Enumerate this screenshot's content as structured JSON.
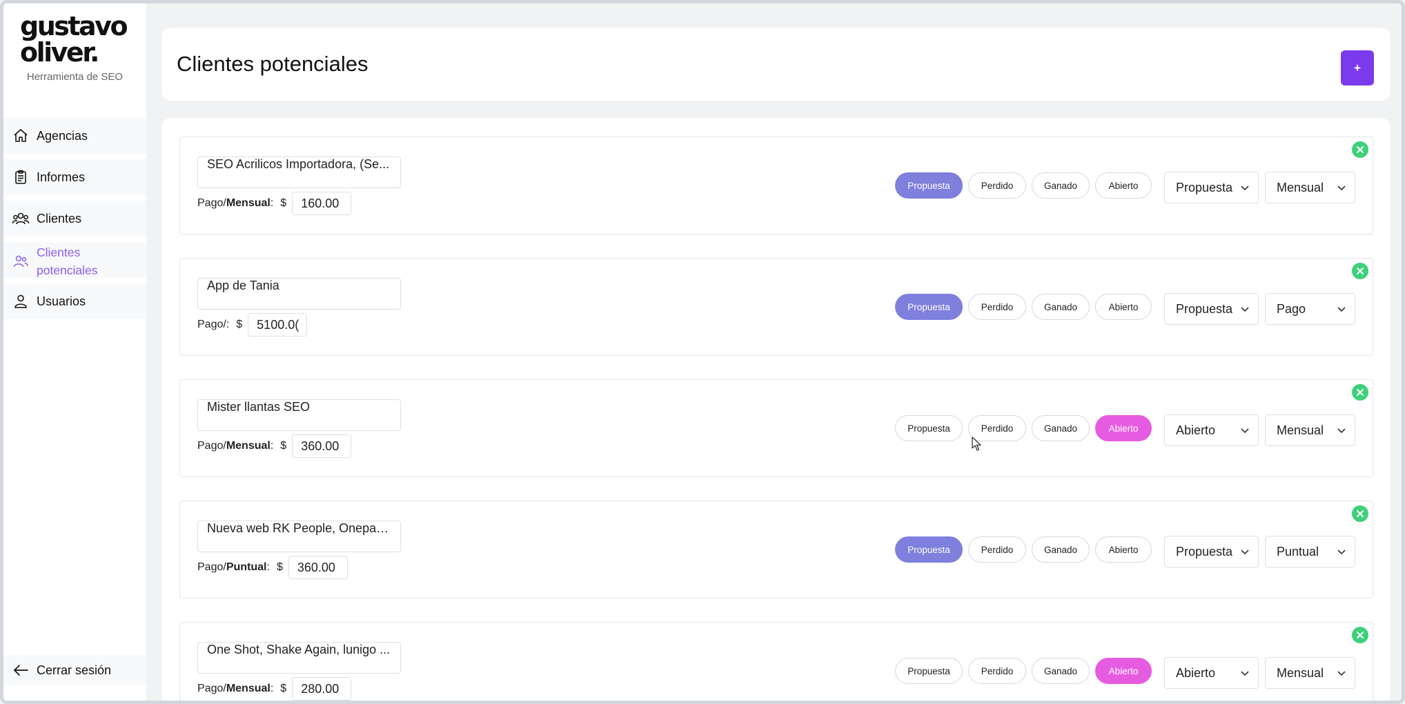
{
  "brand": {
    "logo_line1": "gustavo",
    "logo_line2": "oliver.",
    "subtitle": "Herramienta de SEO"
  },
  "sidebar": {
    "items": [
      {
        "label": "Agencias",
        "icon": "home-icon"
      },
      {
        "label": "Informes",
        "icon": "clipboard-icon"
      },
      {
        "label": "Clientes",
        "icon": "users-icon"
      },
      {
        "label": "Clientes potenciales",
        "icon": "users-outline-icon",
        "active": true
      },
      {
        "label": "Usuarios",
        "icon": "user-icon"
      }
    ],
    "logout_label": "Cerrar sesión"
  },
  "header": {
    "title": "Clientes potenciales",
    "add_label": "+"
  },
  "status_options": [
    "Propuesta",
    "Perdido",
    "Ganado",
    "Abierto"
  ],
  "leads": [
    {
      "name": "SEO Acrilicos Importadora, (Se...",
      "pay_prefix": "Pago/",
      "pay_type": "Mensual",
      "pay_suffix": ":",
      "currency": "$",
      "amount": "160.00",
      "status": "Propuesta",
      "status_select": "Propuesta",
      "frequency": "Mensual"
    },
    {
      "name": "App de Tania",
      "pay_prefix": "Pago/",
      "pay_type": "",
      "pay_suffix": ":",
      "currency": "$",
      "amount": "5100.0(",
      "status": "Propuesta",
      "status_select": "Propuesta",
      "frequency": "Pago"
    },
    {
      "name": "Mister llantas SEO",
      "pay_prefix": "Pago/",
      "pay_type": "Mensual",
      "pay_suffix": ":",
      "currency": "$",
      "amount": "360.00",
      "status": "Abierto",
      "status_select": "Abierto",
      "frequency": "Mensual"
    },
    {
      "name": "Nueva web RK People, Onepag...",
      "pay_prefix": "Pago/",
      "pay_type": "Puntual",
      "pay_suffix": ":",
      "currency": "$",
      "amount": "360.00",
      "status": "Propuesta",
      "status_select": "Propuesta",
      "frequency": "Puntual"
    },
    {
      "name": "One Shot, Shake Again, lunigo ...",
      "pay_prefix": "Pago/",
      "pay_type": "Mensual",
      "pay_suffix": ":",
      "currency": "$",
      "amount": "280.00",
      "status": "Abierto",
      "status_select": "Abierto",
      "frequency": "Mensual"
    }
  ],
  "colors": {
    "accent": "#7c3aed",
    "propuesta_selected": "#7f7fdd",
    "abierto_selected": "#e65ce0",
    "close_green": "#3ed07a",
    "active_nav": "#8b5cf6"
  }
}
